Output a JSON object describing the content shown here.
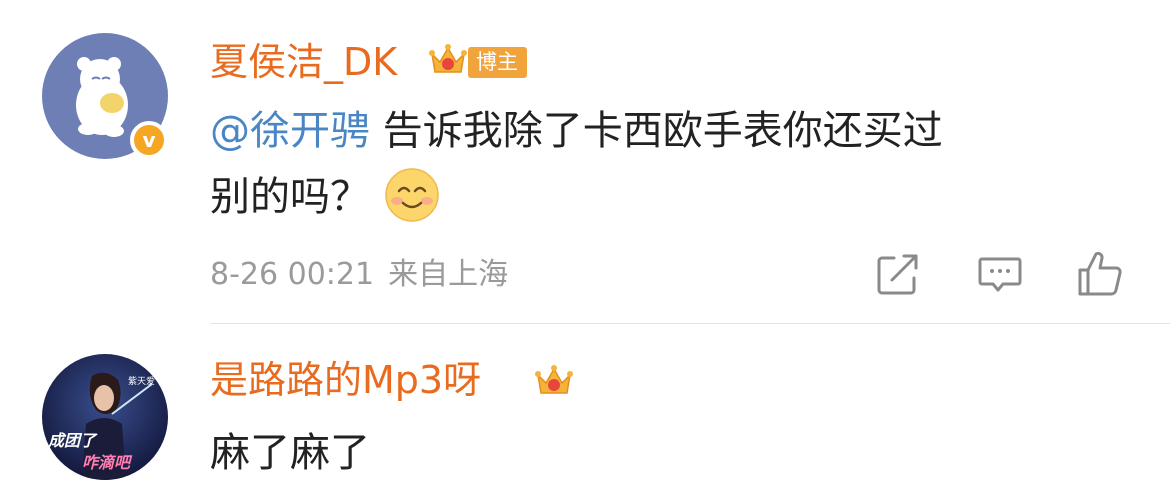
{
  "comments": [
    {
      "username": "夏侯洁_DK",
      "badge_label": "博主",
      "mention": "@徐开骋",
      "text_line1": "告诉我除了卡西欧手表你还买过",
      "text_line2": "别的吗？",
      "emoji": "smile-emoji",
      "date": "8-26 00:21",
      "location": "来自上海",
      "actions": [
        "forward-icon",
        "comment-icon",
        "like-icon"
      ],
      "verified": true
    },
    {
      "username": "是路路的Mp3呀",
      "text": "麻了麻了",
      "avatar_caption": "成团了 咋滴吧",
      "avatar_small_text": "紫天爱"
    }
  ],
  "colors": {
    "username": "#e86b1f",
    "mention": "#4a86c5",
    "meta": "#9a9a9a",
    "badge": "#f2a43c"
  }
}
